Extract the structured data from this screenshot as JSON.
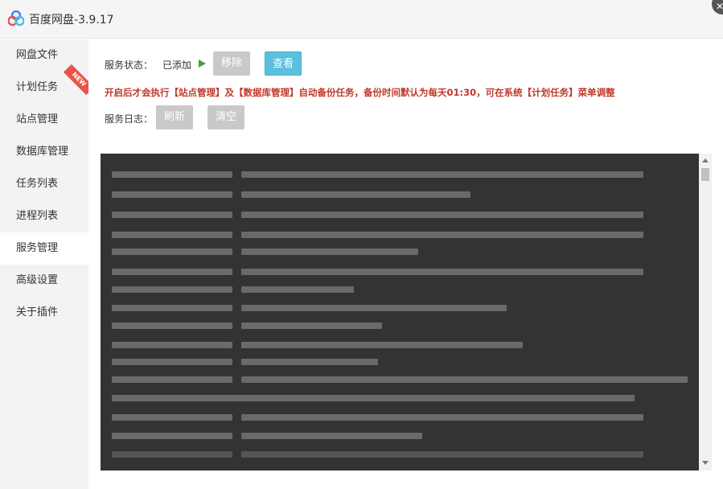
{
  "window": {
    "title": "百度网盘-3.9.17",
    "app_icon": "baidu-netdisk-logo",
    "close_icon": "close-icon"
  },
  "sidebar": {
    "items": [
      {
        "label": "网盘文件",
        "active": false
      },
      {
        "label": "计划任务",
        "active": false,
        "badge": "NEW"
      },
      {
        "label": "站点管理",
        "active": false
      },
      {
        "label": "数据库管理",
        "active": false
      },
      {
        "label": "任务列表",
        "active": false
      },
      {
        "label": "进程列表",
        "active": false
      },
      {
        "label": "服务管理",
        "active": true
      },
      {
        "label": "高级设置",
        "active": false
      },
      {
        "label": "关于插件",
        "active": false
      }
    ]
  },
  "service": {
    "status_label": "服务状态：",
    "status_value": "已添加",
    "status_icon": "play-icon",
    "remove_label": "移除",
    "view_label": "查看",
    "notice": "开启后才会执行【站点管理】及【数据库管理】自动备份任务，备份时间默认为每天01:30，可在系统【计划任务】菜单调整",
    "log_label": "服务日志：",
    "refresh_label": "刷新",
    "clear_label": "清空"
  },
  "colors": {
    "notice": "#c0392b",
    "view_button": "#5bc0de",
    "disabled_button": "#c9c9c9",
    "log_background": "#333333",
    "status_icon": "#3aa53a"
  }
}
